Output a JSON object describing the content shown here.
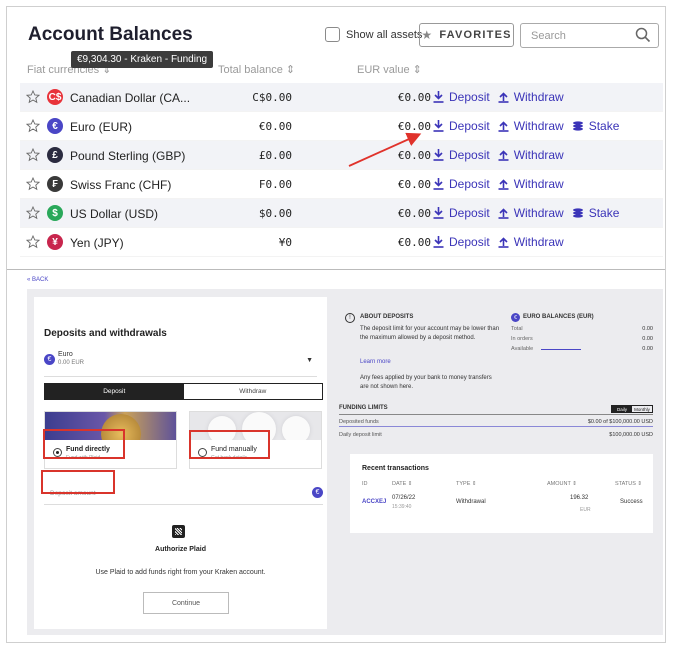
{
  "header": {
    "title": "Account Balances",
    "show_all_label": "Show all assets",
    "favorites_label": "FAVORITES",
    "search_placeholder": "Search"
  },
  "tooltip": "€9,304.30 - Kraken - Funding",
  "columns": {
    "fiat": "Fiat currencies ⇕",
    "total": "Total balance ⇕",
    "eur": "EUR value ⇕"
  },
  "actions": {
    "deposit": "Deposit",
    "withdraw": "Withdraw",
    "stake": "Stake"
  },
  "balances": [
    {
      "name": "Canadian Dollar (CA...",
      "symbol": "C$",
      "color": "#e8333a",
      "total": "C$0.00",
      "eur": "€0.00",
      "stake": false
    },
    {
      "name": "Euro (EUR)",
      "symbol": "€",
      "color": "#4a46c6",
      "total": "€0.00",
      "eur": "€0.00",
      "stake": true
    },
    {
      "name": "Pound Sterling (GBP)",
      "symbol": "£",
      "color": "#2b2b40",
      "total": "£0.00",
      "eur": "€0.00",
      "stake": false
    },
    {
      "name": "Swiss Franc (CHF)",
      "symbol": "₣",
      "color": "#3a3a3a",
      "total": "F0.00",
      "eur": "€0.00",
      "stake": false
    },
    {
      "name": "US Dollar (USD)",
      "symbol": "$",
      "color": "#2aa85a",
      "total": "$0.00",
      "eur": "€0.00",
      "stake": true
    },
    {
      "name": "Yen (JPY)",
      "symbol": "¥",
      "color": "#c8264d",
      "total": "¥0",
      "eur": "€0.00",
      "stake": false
    }
  ],
  "back_label": "« BACK",
  "deposits": {
    "title": "Deposits and withdrawals",
    "currency_name": "Euro",
    "currency_sub": "0.00 EUR",
    "tab_deposit": "Deposit",
    "tab_withdraw": "Withdraw",
    "fund_directly": "Fund directly",
    "fund_directly_sub": "Fund with Plaid",
    "fund_manually": "Fund manually",
    "fund_manually_sub": "Get bank details",
    "amount_placeholder": "Deposit amount",
    "auth_title": "Authorize Plaid",
    "auth_sub": "Use Plaid to add funds right from your Kraken account.",
    "continue_label": "Continue"
  },
  "about": {
    "title": "ABOUT DEPOSITS",
    "text": "The deposit limit for your account may be lower than the maximum allowed by a deposit method.",
    "learn_more": "Learn more",
    "fees": "Any fees applied by your bank to money transfers are not shown here."
  },
  "euro_balances": {
    "title": "EURO BALANCES (EUR)",
    "total_label": "Total",
    "total_value": "0.00",
    "orders_label": "In orders",
    "orders_value": "0.00",
    "available_label": "Available",
    "available_value": "0.00"
  },
  "funding_limits": {
    "title": "FUNDING LIMITS",
    "daily": "Daily",
    "monthly": "Monthly",
    "deposited_label": "Deposited funds",
    "deposited_value": "$0.00 of $100,000.00 USD",
    "daily_label": "Daily deposit limit",
    "daily_value": "$100,000.00 USD"
  },
  "recent": {
    "title": "Recent transactions",
    "headers": {
      "id": "ID",
      "date": "DATE ⇕",
      "type": "TYPE ⇕",
      "amount": "AMOUNT ⇕",
      "status": "STATUS ⇕"
    },
    "row": {
      "id": "ACCXEJ",
      "date": "07/26/22",
      "time": "15:39:40",
      "type": "Withdrawal",
      "amount": "196.32",
      "currency": "EUR",
      "status": "Success"
    }
  }
}
